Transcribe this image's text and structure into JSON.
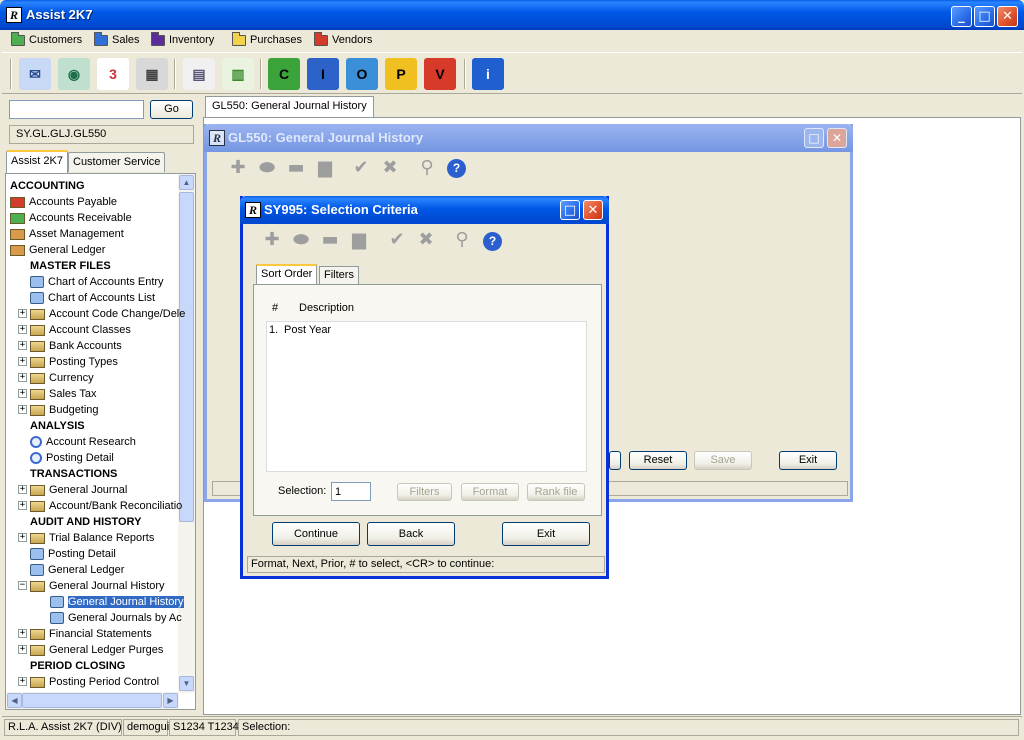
{
  "app": {
    "title": "Assist 2K7",
    "logo_letters": "R",
    "buttons": {
      "minimize": "_",
      "maximize": "□",
      "close": "✕"
    }
  },
  "menubar": {
    "items": [
      {
        "label": "Customers",
        "color": "#4caf50"
      },
      {
        "label": "Sales",
        "color": "#2f6fd6"
      },
      {
        "label": "Inventory",
        "color": "#5b2c9a"
      },
      {
        "label": "Purchases",
        "color": "#f2d24a"
      },
      {
        "label": "Vendors",
        "color": "#d33b2b"
      }
    ]
  },
  "toolbar": {
    "icons": [
      {
        "name": "mail-icon",
        "glyph": "✉",
        "bg": "#c7d9f5",
        "fg": "#2a4e8f"
      },
      {
        "name": "globe-icon",
        "glyph": "◉",
        "bg": "#bfe0cf",
        "fg": "#1f6e4c"
      },
      {
        "name": "calendar-icon",
        "glyph": "3",
        "bg": "#ffffff",
        "fg": "#c33"
      },
      {
        "name": "calculator-icon",
        "glyph": "▦",
        "bg": "#d8d8d8",
        "fg": "#444"
      },
      {
        "name": "form-icon",
        "glyph": "▤",
        "bg": "#f0f0f0",
        "fg": "#557"
      },
      {
        "name": "report-icon",
        "glyph": "▥",
        "bg": "#e9f3e0",
        "fg": "#3a8a2a"
      },
      {
        "name": "customers-c-icon",
        "glyph": "C",
        "bg": "#3aa33a",
        "fg": "#000"
      },
      {
        "name": "inventory-i-icon",
        "glyph": "I",
        "bg": "#2d63c9",
        "fg": "#000"
      },
      {
        "name": "orders-o-icon",
        "glyph": "O",
        "bg": "#3a8fd8",
        "fg": "#000"
      },
      {
        "name": "purchases-p-icon",
        "glyph": "P",
        "bg": "#f0c020",
        "fg": "#000"
      },
      {
        "name": "vendors-v-icon",
        "glyph": "V",
        "bg": "#d83a2a",
        "fg": "#000"
      },
      {
        "name": "info-icon",
        "glyph": "i",
        "bg": "#1f5fd0",
        "fg": "#fff"
      }
    ]
  },
  "sidebar": {
    "search_value": "",
    "go_label": "Go",
    "path": "SY.GL.GLJ.GL550",
    "tabs": [
      {
        "label": "Assist 2K7"
      },
      {
        "label": "Customer Service"
      }
    ],
    "tree": [
      {
        "label": "ACCOUNTING",
        "kind": "header",
        "indent": 0
      },
      {
        "label": "Accounts Payable",
        "kind": "folder",
        "indent": 0,
        "color": "#d33b2b"
      },
      {
        "label": "Accounts Receivable",
        "kind": "folder",
        "indent": 0,
        "color": "#4caf50"
      },
      {
        "label": "Asset Management",
        "kind": "folder",
        "indent": 0,
        "color": "#d99a4c"
      },
      {
        "label": "General Ledger",
        "kind": "folder",
        "indent": 0,
        "color": "#d99a4c"
      },
      {
        "label": "MASTER FILES",
        "kind": "header",
        "indent": 1
      },
      {
        "label": "Chart of Accounts Entry",
        "kind": "doc",
        "indent": 2
      },
      {
        "label": "Chart of Accounts List",
        "kind": "doc",
        "indent": 2
      },
      {
        "label": "Account Code Change/Dele",
        "kind": "folder",
        "indent": 2,
        "expander": "+"
      },
      {
        "label": "Account Classes",
        "kind": "folder",
        "indent": 2,
        "expander": "+"
      },
      {
        "label": "Bank Accounts",
        "kind": "folder",
        "indent": 2,
        "expander": "+"
      },
      {
        "label": "Posting Types",
        "kind": "folder",
        "indent": 2,
        "expander": "+"
      },
      {
        "label": "Currency",
        "kind": "folder",
        "indent": 2,
        "expander": "+"
      },
      {
        "label": "Sales Tax",
        "kind": "folder",
        "indent": 2,
        "expander": "+"
      },
      {
        "label": "Budgeting",
        "kind": "folder",
        "indent": 2,
        "expander": "+"
      },
      {
        "label": "ANALYSIS",
        "kind": "header",
        "indent": 1
      },
      {
        "label": "Account Research",
        "kind": "mag",
        "indent": 2
      },
      {
        "label": "Posting Detail",
        "kind": "mag",
        "indent": 2
      },
      {
        "label": "TRANSACTIONS",
        "kind": "header",
        "indent": 1
      },
      {
        "label": "General Journal",
        "kind": "folder",
        "indent": 2,
        "expander": "+"
      },
      {
        "label": "Account/Bank Reconciliatio",
        "kind": "folder",
        "indent": 2,
        "expander": "+"
      },
      {
        "label": "AUDIT AND HISTORY",
        "kind": "header",
        "indent": 1
      },
      {
        "label": "Trial Balance Reports",
        "kind": "folder",
        "indent": 2,
        "expander": "+"
      },
      {
        "label": "Posting Detail",
        "kind": "doc",
        "indent": 2
      },
      {
        "label": "General Ledger",
        "kind": "doc",
        "indent": 2
      },
      {
        "label": "General Journal History",
        "kind": "folder",
        "indent": 2,
        "expander": "−"
      },
      {
        "label": "General Journal History",
        "kind": "doc",
        "indent": 3,
        "selected": true
      },
      {
        "label": "General Journals by Ac",
        "kind": "doc",
        "indent": 3
      },
      {
        "label": "Financial Statements",
        "kind": "folder",
        "indent": 2,
        "expander": "+"
      },
      {
        "label": "General Ledger Purges",
        "kind": "folder",
        "indent": 2,
        "expander": "+"
      },
      {
        "label": "PERIOD CLOSING",
        "kind": "header",
        "indent": 1
      },
      {
        "label": "Posting Period Control",
        "kind": "folder",
        "indent": 2,
        "expander": "+"
      }
    ]
  },
  "document_tab": {
    "label": "GL550: General Journal History"
  },
  "gl550": {
    "title": "GL550: General Journal History",
    "buttons": {
      "reset": "Reset",
      "save": "Save",
      "exit": "Exit"
    }
  },
  "sy995": {
    "title": "SY995: Selection Criteria",
    "tabs": [
      {
        "label": "Sort Order"
      },
      {
        "label": "Filters"
      }
    ],
    "list_headers": {
      "num": "#",
      "desc": "Description"
    },
    "list_rows": [
      {
        "num": "1.",
        "desc": "Post Year"
      }
    ],
    "selection_label": "Selection:",
    "selection_value": "1",
    "panel_buttons": {
      "filters": "Filters",
      "format": "Format",
      "rank_file": "Rank file"
    },
    "buttons": {
      "continue": "Continue",
      "back": "Back",
      "exit": "Exit"
    },
    "status": "Format,  Next,  Prior,  # to select,  <CR> to continue:"
  },
  "statusbar": {
    "cells": [
      "R.L.A. Assist 2K7 (DIV)",
      "demogui",
      "S1234 T1234",
      "Selection:"
    ]
  }
}
